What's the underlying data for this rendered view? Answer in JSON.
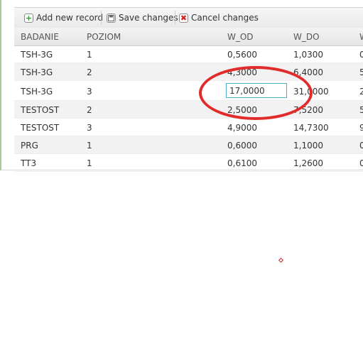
{
  "toolbar": {
    "add_label": "Add new record",
    "save_label": "Save changes",
    "cancel_label": "Cancel changes",
    "add_icon": "+",
    "cancel_icon": "✖"
  },
  "columns": [
    "BADANIE",
    "POZIOM",
    "W_OD",
    "W_DO",
    "W"
  ],
  "rows": [
    [
      "TSH-3G",
      "1",
      "0,5600",
      "1,0300",
      "0"
    ],
    [
      "TSH-3G",
      "2",
      "4,3000",
      "6,4000",
      "5"
    ],
    [
      "TSH-3G",
      "3",
      "",
      "31,0000",
      "2"
    ],
    [
      "TESTOST",
      "2",
      "2,5000",
      "7,5200",
      "5"
    ],
    [
      "TESTOST",
      "3",
      "4,9000",
      "14,7300",
      "9"
    ],
    [
      "PRG",
      "1",
      "0,6000",
      "1,1000",
      "0"
    ],
    [
      "TT3",
      "1",
      "0,6100",
      "1,2600",
      "0"
    ]
  ],
  "editor": {
    "value": "17,0000"
  },
  "colors": {
    "highlight": "#e22b2b",
    "editor_border": "#4fb0c6"
  }
}
